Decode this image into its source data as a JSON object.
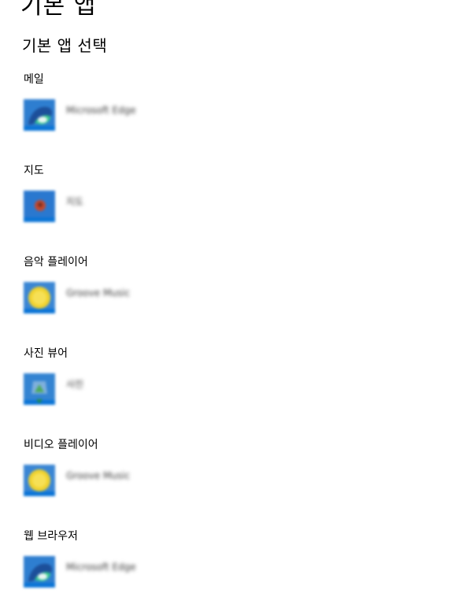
{
  "page_title": "기본 앱",
  "section_title": "기본 앱 선택",
  "categories": [
    {
      "label": "메일",
      "app_name": "Microsoft Edge",
      "icon": "edge-icon"
    },
    {
      "label": "지도",
      "app_name": "지도",
      "icon": "maps-icon"
    },
    {
      "label": "음악 플레이어",
      "app_name": "Groove Music",
      "icon": "groove-music-icon"
    },
    {
      "label": "사진 뷰어",
      "app_name": "사진",
      "icon": "photos-icon"
    },
    {
      "label": "비디오 플레이어",
      "app_name": "Groove Music",
      "icon": "groove-music-icon"
    },
    {
      "label": "웹 브라우저",
      "app_name": "Microsoft Edge",
      "icon": "edge-icon"
    }
  ],
  "colors": {
    "tile_blue": "#0a74d6",
    "edge_green": "#36c98d",
    "groove_yellow": "#f0d22e",
    "maps_red": "#c4492e"
  }
}
